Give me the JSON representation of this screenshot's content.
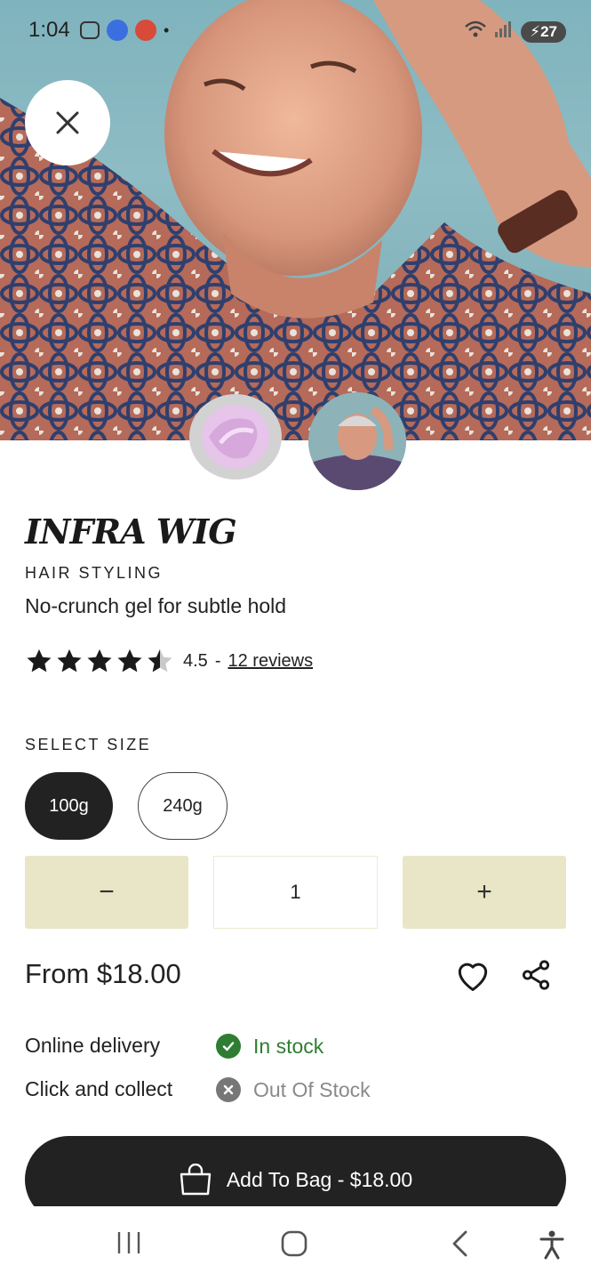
{
  "status_bar": {
    "time": "1:04",
    "battery": "27"
  },
  "product": {
    "name": "INFRA WIG",
    "category": "HAIR STYLING",
    "tagline": "No-crunch gel for subtle hold",
    "rating": 4.5,
    "rating_text": "4.5",
    "reviews_link": "12 reviews"
  },
  "size": {
    "label": "SELECT SIZE",
    "options": [
      "100g",
      "240g"
    ],
    "selected": "100g"
  },
  "quantity": {
    "minus": "−",
    "value": "1",
    "plus": "+"
  },
  "price": "From $18.00",
  "availability": {
    "online_label": "Online delivery",
    "online_status": "In stock",
    "collect_label": "Click and collect",
    "collect_status": "Out Of Stock"
  },
  "cta": {
    "add_to_bag": "Add To Bag - $18.00"
  },
  "colors": {
    "accent_qty": "#e8e6c6",
    "in_stock": "#2e7d32",
    "out_stock": "#8a8a8a",
    "primary": "#222222"
  }
}
